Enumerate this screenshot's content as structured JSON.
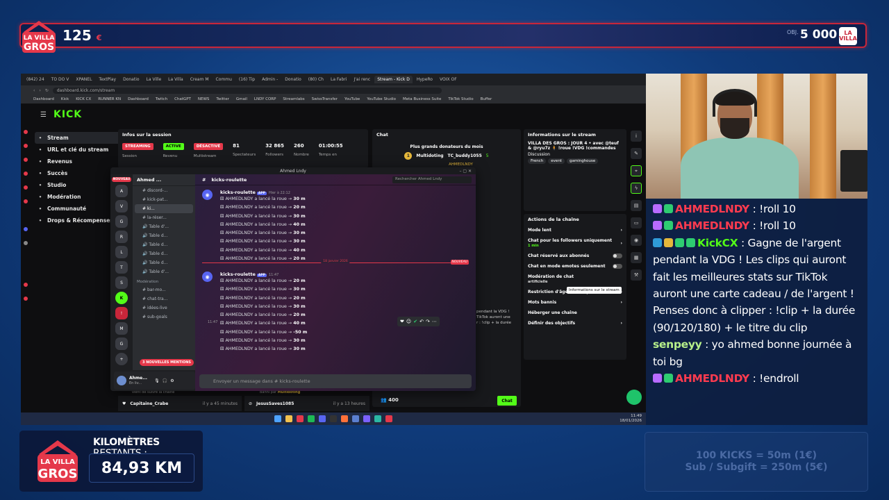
{
  "overlay_top": {
    "logo_text": "LA VILLA DES GROS",
    "count": "125",
    "count_unit": "€",
    "goal_label": "OBJ.",
    "goal_value": "5 000",
    "goal_unit": "€"
  },
  "browser": {
    "tabs": [
      "(842) 24",
      "TO DO V",
      "XPANEL",
      "TextPlay",
      "Donatio",
      "La Ville",
      "La Villa",
      "Cream M",
      "Commu",
      "(16) Tip",
      "Admin -",
      "Donatio",
      "(80) Ch",
      "La Fabri",
      "J'ai renc",
      "Stream - Kick D",
      "HypeRo",
      "VOIX OF"
    ],
    "url": "dashboard.kick.com/stream",
    "bookmarks": [
      "Dashboard",
      "Kick",
      "KICK CX",
      "RUNNER KN",
      "Dashboard",
      "Twitch",
      "ChatGPT",
      "NEWS",
      "Twitter",
      "Gmail",
      "LNDY CORP",
      "Streamlabs",
      "SwissTransfer",
      "YouTube",
      "YouTube Studio",
      "Meta Business Suite",
      "TikTok Studio",
      "Buffer"
    ]
  },
  "kick": {
    "logo": "KICK",
    "nav": [
      {
        "label": "Stream",
        "icon": "stream-icon"
      },
      {
        "label": "URL et clé du stream",
        "icon": "key-icon"
      },
      {
        "label": "Revenus",
        "icon": "money-icon"
      },
      {
        "label": "Succès",
        "icon": "trophy-icon"
      },
      {
        "label": "Studio",
        "icon": "studio-icon"
      },
      {
        "label": "Modération",
        "icon": "shield-icon"
      },
      {
        "label": "Communauté",
        "icon": "community-icon"
      },
      {
        "label": "Drops & Récompenses",
        "icon": "gift-icon"
      }
    ],
    "session": {
      "title": "Infos sur la session",
      "stats": [
        {
          "top": "STREAMING",
          "bottom": "Session",
          "pill_color": "#e5384a"
        },
        {
          "top": "ACTIVE",
          "bottom": "Revenu",
          "pill_color": "#53fc18"
        },
        {
          "top": "DÉSACTIVÉ",
          "bottom": "Multistream",
          "pill_color": "#e5384a"
        },
        {
          "top": "81",
          "bottom": "Spectateurs"
        },
        {
          "top": "32 865",
          "bottom": "Followers"
        },
        {
          "top": "260",
          "bottom": "Nombre"
        },
        {
          "top": "01:00:55",
          "bottom": "Temps en"
        }
      ]
    },
    "chat": {
      "title": "Chat",
      "donors_title": "Plus grands donateurs du mois",
      "donor_rank": "1",
      "donor_1": "Multidoting",
      "donor_2": "TC_buddy1055",
      "donor_3": "AHMEDLNDY",
      "donor_amount": "5",
      "partial_1": "pendant la VDG !",
      "partial_2": "TikTok auront une",
      "partial_3": "r : !clip + la durée",
      "count": "400",
      "send": "Chat"
    },
    "info": {
      "title": "Informations sur le stream",
      "stream_title": "VILLA DES GROS : JOUR 4 • avec @teuf & @ryu7z 🧍 !roue !VDG !commandes",
      "category": "Discussion",
      "tags": [
        "French",
        "event",
        "gaminghouse"
      ]
    },
    "actions": {
      "title": "Actions de la chaîne",
      "rows": [
        {
          "label": "Mode lent",
          "control": "arrow"
        },
        {
          "label": "Chat pour les followers uniquement",
          "sub": "1 min",
          "control": "arrow"
        },
        {
          "label": "Chat réservé aux abonnés",
          "control": "toggle"
        },
        {
          "label": "Chat en mode emotes seulement",
          "control": "toggle"
        },
        {
          "label": "Modération de chat",
          "sub": "artificielle",
          "control": "none"
        },
        {
          "label": "Restriction d'âge du compte",
          "control": "arrow"
        },
        {
          "label": "Mots bannis",
          "control": "arrow"
        },
        {
          "label": "Héberger une chaîne",
          "control": "none"
        },
        {
          "label": "Définir des objectifs",
          "control": "arrow"
        }
      ],
      "tooltip": "Informations sur le stream"
    },
    "feed": {
      "left_top": "vient de suivre la chaîne",
      "left_name": "Capitaine_Crabe",
      "left_time": "il y a 45 minutes",
      "mid_top": "Banni par",
      "mid_top_name": "Multidoting",
      "mid_name": "JesusSaves1085",
      "mid_time": "il y a 13 heures"
    }
  },
  "discord": {
    "window_title": "Ahmed Lndy",
    "server_name": "Ahmed ...",
    "new_label": "NOUVEAU",
    "channel_header": "kicks-roulette",
    "search_placeholder": "Rechercher Ahmed Lndy",
    "channels": [
      "discord-...",
      "kick-pat...",
      "ki...",
      "la-réser...",
      "Table d'...",
      "Table d...",
      "Table d...",
      "Table d...",
      "Table d...",
      "Table d'..."
    ],
    "mod_category": "Modération",
    "mod_channels": [
      "bar-mo...",
      "chat-tra...",
      "idées-live",
      "sub-goals"
    ],
    "mentions": "3 NOUVELLES MENTIONS",
    "user_name": "Ahme...",
    "user_status": "En liv...",
    "bot_name": "kicks-roulette",
    "bot_tag": "APP",
    "old_time": "Hier à 22:12",
    "new_time": "11:47",
    "hover_time": "11:47",
    "date_sep": "18 janvier 2026",
    "new_sep": "NOUVEAU",
    "old_lines": [
      {
        "who": "AHMEDLNDY",
        "text": " a lancé la roue → ",
        "val": "30 m"
      },
      {
        "who": "AHMEDLNDY",
        "text": " a lancé la roue → ",
        "val": "20 m"
      },
      {
        "who": "AHMEDLNDY",
        "text": " a lancé la roue → ",
        "val": "30 m"
      },
      {
        "who": "AHMEDLNDY",
        "text": " a lancé la roue → ",
        "val": "40 m"
      },
      {
        "who": "AHMEDLNDY",
        "text": " a lancé la roue → ",
        "val": "30 m"
      },
      {
        "who": "AHMEDLNDY",
        "text": " a lancé la roue → ",
        "val": "30 m"
      },
      {
        "who": "AHMEDLNDY",
        "text": " a lancé la roue → ",
        "val": "40 m"
      },
      {
        "who": "AHMEDLNDY",
        "text": " a lancé la roue → ",
        "val": "20 m"
      }
    ],
    "new_lines": [
      {
        "who": "AHMEDLNDY",
        "text": " a lancé la roue → ",
        "val": "20 m"
      },
      {
        "who": "AHMEDLNDY",
        "text": " a lancé la roue → ",
        "val": "30 m"
      },
      {
        "who": "AHMEDLNDY",
        "text": " a lancé la roue → ",
        "val": "20 m"
      },
      {
        "who": "AHMEDLNDY",
        "text": " a lancé la roue → ",
        "val": "30 m"
      },
      {
        "who": "AHMEDLNDY",
        "text": " a lancé la roue → ",
        "val": "20 m"
      },
      {
        "who": "AHMEDLNDY",
        "text": " a lancé la roue → ",
        "val": "40 m"
      },
      {
        "who": "AHMEDLNDY",
        "text": " a lancé la roue → ",
        "val": "-50 m"
      },
      {
        "who": "AHMEDLNDY",
        "text": " a lancé la roue → ",
        "val": "30 m"
      },
      {
        "who": "AHMEDLNDY",
        "text": " a lancé la roue → ",
        "val": "30 m"
      }
    ],
    "input_placeholder": "Envoyer un message dans #  kicks-roulette"
  },
  "taskbar": {
    "time": "11:49",
    "date": "18/01/2026"
  },
  "stream_chat": [
    {
      "name": "AHMEDLNDY",
      "color": "#ff3b4f",
      "text": " : !roll 10",
      "badges": [
        "#b86bff",
        "#2ecc71"
      ]
    },
    {
      "name": "AHMEDLNDY",
      "color": "#ff3b4f",
      "text": " : !roll 10",
      "badges": [
        "#b86bff",
        "#2ecc71"
      ]
    },
    {
      "name": "KickCX",
      "color": "#53fc18",
      "text": " : Gagne de l'argent pendant la VDG ! Les clips qui auront fait les meilleures stats sur TikTok auront une carte cadeau / de l'argent ! Penses donc à clipper : !clip + la durée (90/120/180) + le titre du clip",
      "badges": [
        "#2f9bd8",
        "#e5b73b",
        "#2ecc71",
        "#2ecc71"
      ]
    },
    {
      "name": "senpeyy",
      "color": "#b7f08a",
      "text": " : yo ahmed bonne journée à toi bg",
      "badges": []
    },
    {
      "name": "AHMEDLNDY",
      "color": "#ff3b4f",
      "text": " : !endroll",
      "badges": [
        "#b86bff",
        "#2ecc71"
      ]
    }
  ],
  "km": {
    "label_bold": "KILOMÈTRES",
    "label_rest": " RESTANTS :",
    "value": "84,93 KM"
  },
  "prices": {
    "line1": "100 KICKS = 50m (1€)",
    "line2": "Sub / Subgift = 250m (5€)"
  },
  "colors": {
    "kick_green": "#53fc18",
    "accent_red": "#e5384a",
    "overlay_blue": "#0f3a79"
  }
}
